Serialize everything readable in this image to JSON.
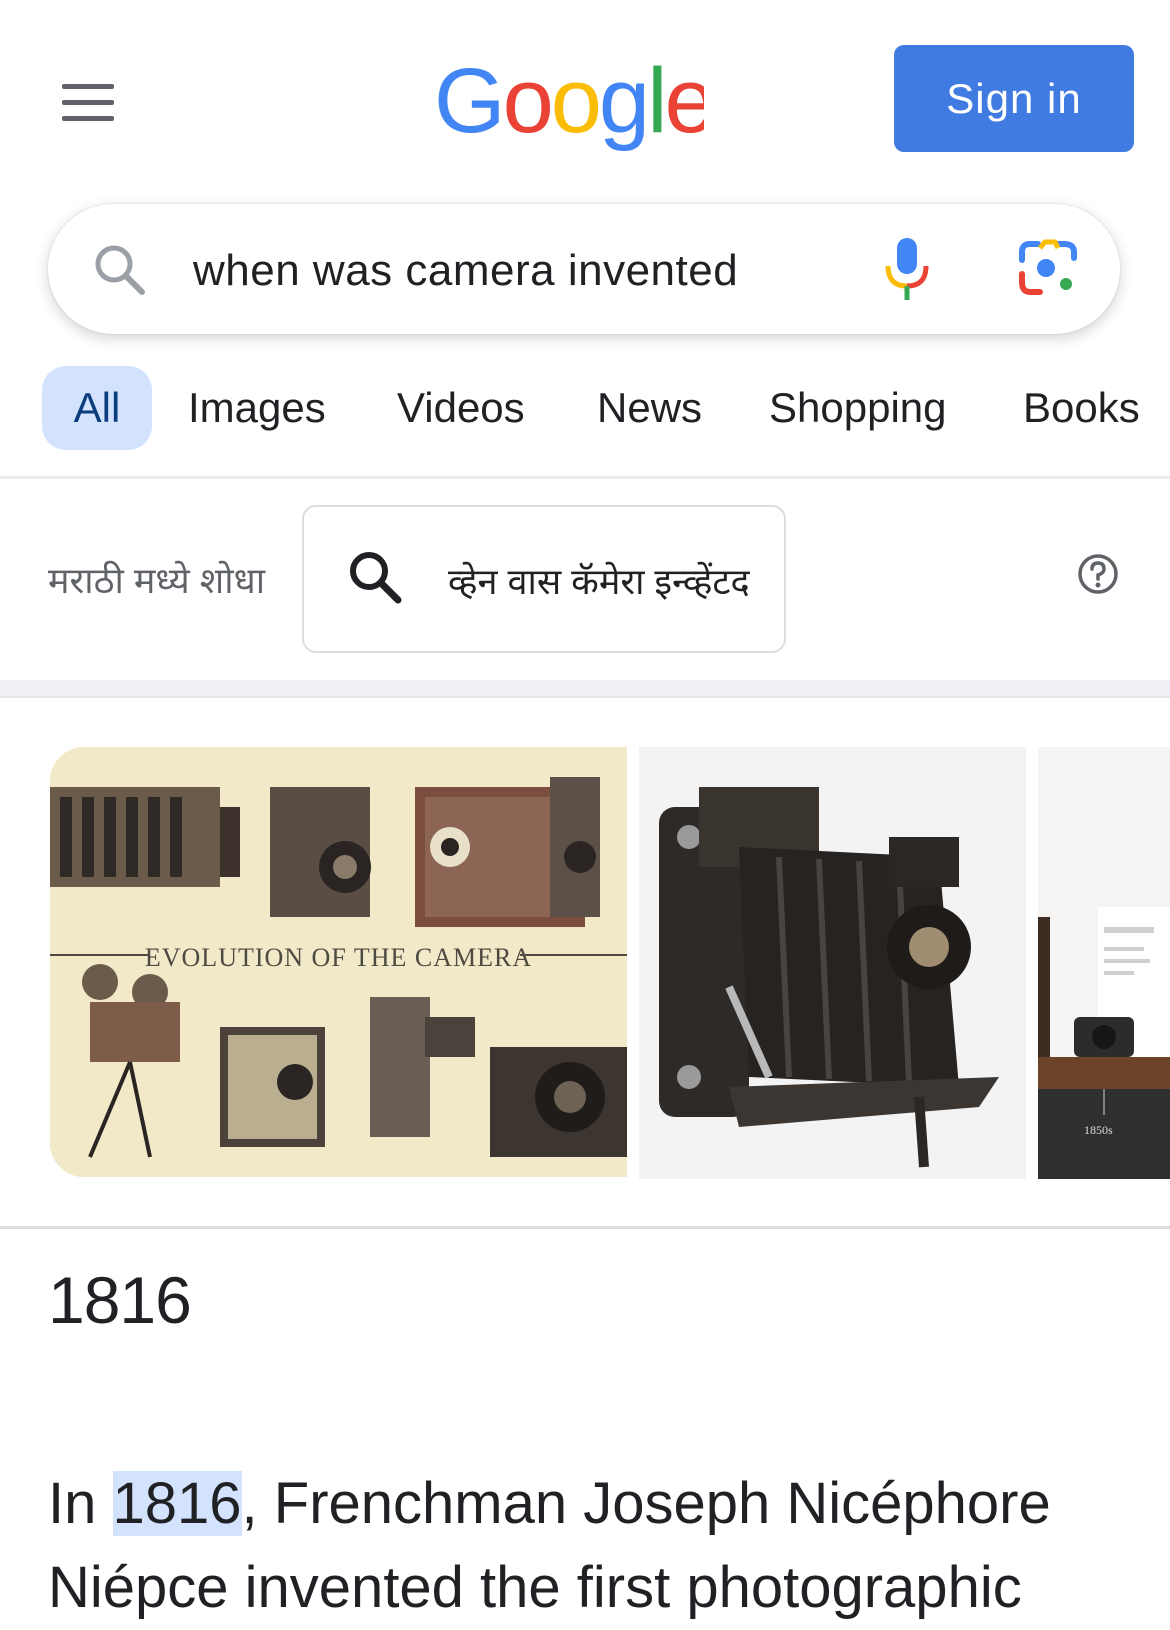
{
  "header": {
    "logo": {
      "letters": [
        "G",
        "o",
        "o",
        "g",
        "l",
        "e"
      ],
      "colors": [
        "#4285F4",
        "#EA4335",
        "#FBBC05",
        "#4285F4",
        "#34A853",
        "#EA4335"
      ]
    },
    "sign_in_label": "Sign in",
    "menu_icon": "hamburger-menu-icon"
  },
  "search": {
    "query": "when was camera invented",
    "icons": [
      "search-icon",
      "mic-icon",
      "lens-icon"
    ]
  },
  "tabs": [
    {
      "label": "All",
      "selected": true
    },
    {
      "label": "Images",
      "selected": false
    },
    {
      "label": "Videos",
      "selected": false
    },
    {
      "label": "News",
      "selected": false
    },
    {
      "label": "Shopping",
      "selected": false
    },
    {
      "label": "Books",
      "selected": false
    }
  ],
  "translation": {
    "label": "मराठी मध्ये शोधा",
    "query": "व्हेन वास कॅमेरा इन्व्हेंटद",
    "help_icon": "help-circle-icon"
  },
  "images": [
    {
      "caption": "EVOLUTION OF THE CAMERA"
    },
    {
      "caption": ""
    },
    {
      "caption": "1850s"
    }
  ],
  "answer": {
    "title": "1816",
    "snippet_before": "In ",
    "snippet_highlight": "1816",
    "snippet_after": ", Frenchman Joseph Nicéphore Niépce invented the first photographic"
  },
  "colors": {
    "accent": "#3f7be0",
    "tab_selected_bg": "#d3e3fd"
  }
}
